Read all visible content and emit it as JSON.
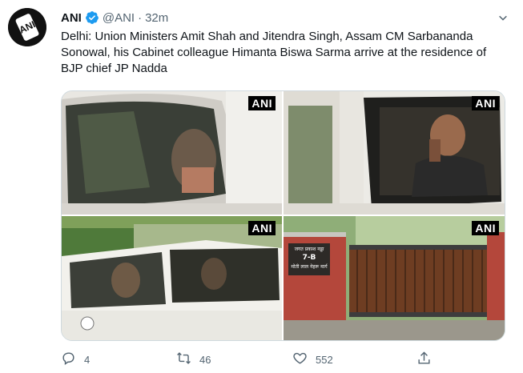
{
  "tweet": {
    "author_name": "ANI",
    "author_handle": "@ANI",
    "separator": "·",
    "time": "32m",
    "text": "Delhi: Union Ministers Amit Shah and Jitendra Singh, Assam CM Sarbananda Sonowal, his Cabinet colleague Himanta Biswa Sarma arrive at the residence of BJP chief JP Nadda",
    "avatar_logo_text": "ANI"
  },
  "media": {
    "photos": [
      {
        "watermark": "ANI"
      },
      {
        "watermark": "ANI"
      },
      {
        "watermark": "ANI"
      },
      {
        "watermark": "ANI",
        "sign_line1": "जगत प्रकाश नड्डा",
        "sign_line2": "7-B",
        "sign_line3": "मोती लाल नेहरू मार्ग"
      }
    ]
  },
  "actions": {
    "reply_count": "4",
    "retweet_count": "46",
    "like_count": "552"
  },
  "icons": {
    "verified": "verified-badge-icon",
    "more": "chevron-down-icon",
    "reply": "reply-icon",
    "retweet": "retweet-icon",
    "like": "heart-icon",
    "share": "share-icon"
  },
  "colors": {
    "verified_blue": "#1d9bf0",
    "secondary_text": "#536471",
    "primary_text": "#0f1419"
  }
}
